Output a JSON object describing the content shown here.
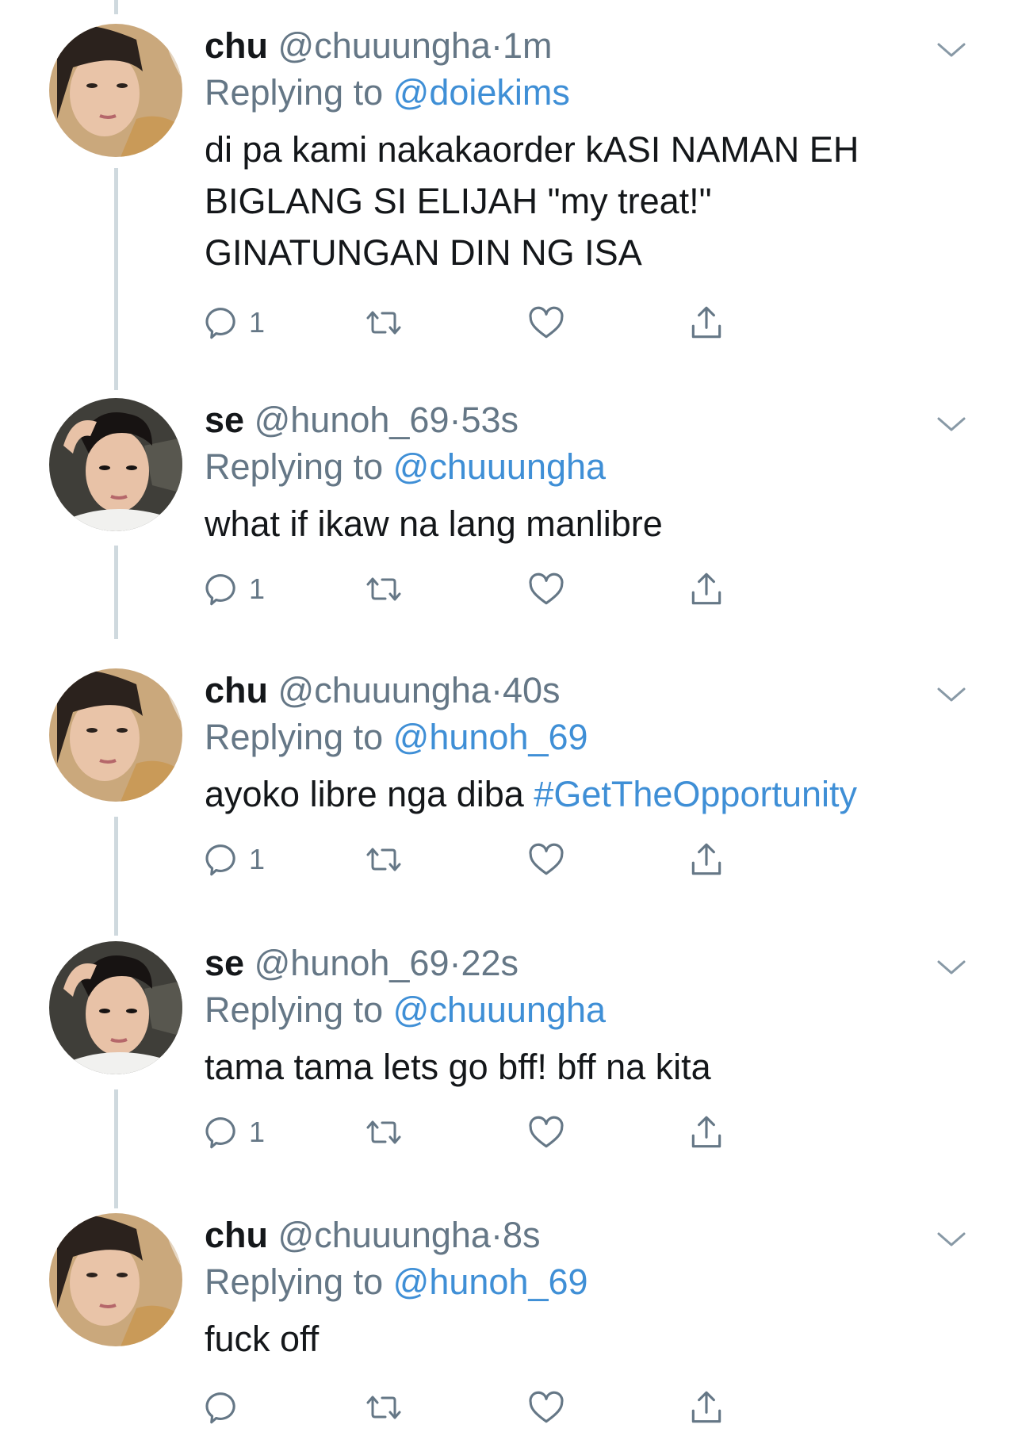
{
  "thread": [
    {
      "display_name": "chu",
      "handle": "@chuuungha",
      "separator": "·",
      "time": "1m",
      "replying_prefix": "Replying to",
      "replying_to": "@doiekims",
      "text_lines": [
        "di pa kami nakakaorder kASI NAMAN EH",
        "BIGLANG SI ELIJAH \"my treat!\"",
        "GINATUNGAN DIN NG ISA"
      ],
      "hashtag": "",
      "reply_count": "1",
      "avatar_icon": "avatar-chu"
    },
    {
      "display_name": "se",
      "handle": "@hunoh_69",
      "separator": "·",
      "time": "53s",
      "replying_prefix": "Replying to",
      "replying_to": "@chuuungha",
      "text_lines": [
        "what if ikaw na lang manlibre"
      ],
      "hashtag": "",
      "reply_count": "1",
      "avatar_icon": "avatar-se"
    },
    {
      "display_name": "chu",
      "handle": "@chuuungha",
      "separator": "·",
      "time": "40s",
      "replying_prefix": "Replying to",
      "replying_to": "@hunoh_69",
      "text_lines": [
        "ayoko libre nga diba "
      ],
      "hashtag": "#GetTheOpportunity",
      "reply_count": "1",
      "avatar_icon": "avatar-chu"
    },
    {
      "display_name": "se",
      "handle": "@hunoh_69",
      "separator": "·",
      "time": "22s",
      "replying_prefix": "Replying to",
      "replying_to": "@chuuungha",
      "text_lines": [
        "tama tama lets go bff! bff na kita"
      ],
      "hashtag": "",
      "reply_count": "1",
      "avatar_icon": "avatar-se"
    },
    {
      "display_name": "chu",
      "handle": "@chuuungha",
      "separator": "·",
      "time": "8s",
      "replying_prefix": "Replying to",
      "replying_to": "@hunoh_69",
      "text_lines": [
        "fuck off"
      ],
      "hashtag": "",
      "reply_count": "",
      "avatar_icon": "avatar-chu"
    }
  ],
  "icons": {
    "reply": "reply-icon",
    "retweet": "retweet-icon",
    "like": "heart-icon",
    "share": "share-icon",
    "more": "chevron-down-icon"
  },
  "colors": {
    "text": "#14171a",
    "secondary": "#657786",
    "link": "#3f8fd6",
    "thread_line": "#cfd9de"
  }
}
